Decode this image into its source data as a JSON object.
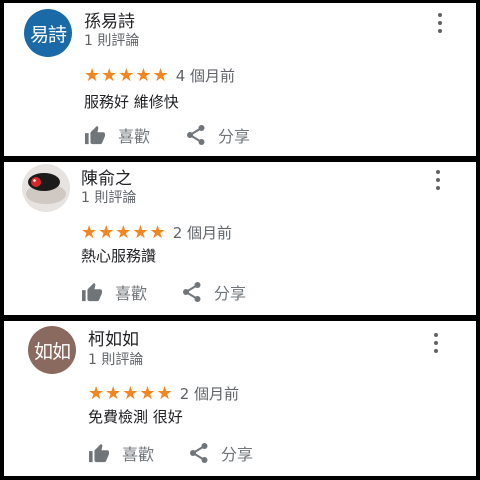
{
  "share_label": "分享",
  "like_label": "喜歡",
  "reviews": [
    {
      "avatar_text": "易詩",
      "avatar_color": "#1a6aa8",
      "name": "孫易詩",
      "review_count": "1 則評論",
      "stars": "★★★★★",
      "rating": 5,
      "time": "4 個月前",
      "text": "服務好 維修快"
    },
    {
      "avatar_text": "",
      "avatar_color": "#f2f2f2",
      "name": "陳俞之",
      "review_count": "1 則評論",
      "stars": "★★★★★",
      "rating": 5,
      "time": "2 個月前",
      "text": "熱心服務讚"
    },
    {
      "avatar_text": "如如",
      "avatar_color": "#8a6a5e",
      "name": "柯如如",
      "review_count": "1 則評論",
      "stars": "★★★★★",
      "rating": 5,
      "time": "2 個月前",
      "text": "免費檢測 很好"
    }
  ]
}
